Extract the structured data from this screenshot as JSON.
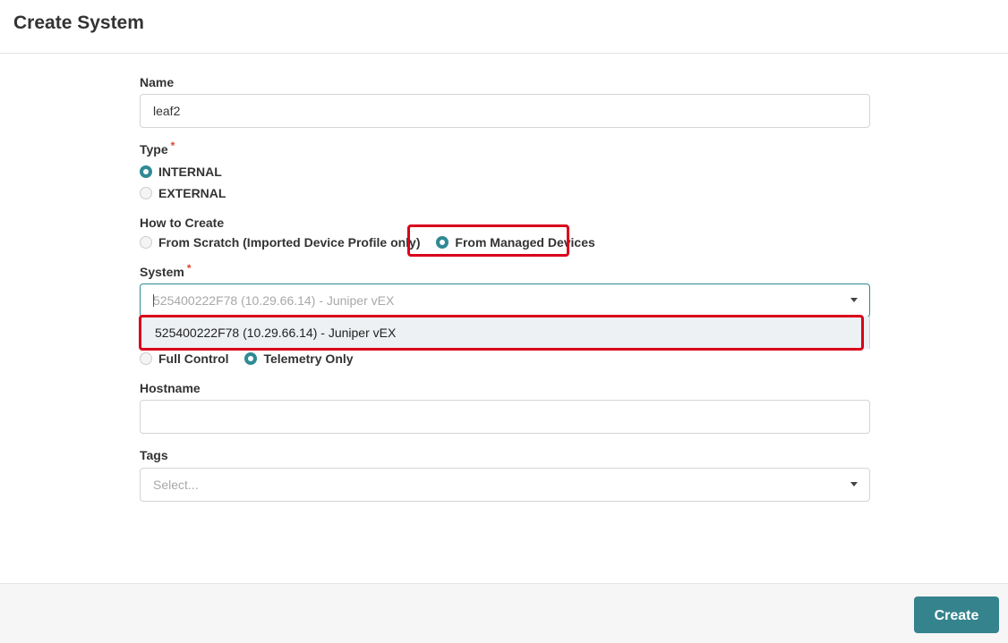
{
  "header": {
    "title": "Create System"
  },
  "form": {
    "name": {
      "label": "Name",
      "value": "leaf2"
    },
    "type": {
      "label": "Type",
      "required_mark": "*",
      "options": [
        {
          "label": "INTERNAL",
          "checked": true
        },
        {
          "label": "EXTERNAL",
          "checked": false
        }
      ]
    },
    "how_to_create": {
      "label": "How to Create",
      "options": [
        {
          "label": "From Scratch (Imported Device Profile only)",
          "checked": false
        },
        {
          "label": "From Managed Devices",
          "checked": true
        }
      ]
    },
    "system": {
      "label": "System",
      "required_mark": "*",
      "placeholder": "525400222F78 (10.29.66.14) - Juniper vEX",
      "dropdown_items": [
        "525400222F78 (10.29.66.14) - Juniper vEX"
      ]
    },
    "control": {
      "options": [
        {
          "label": "Full Control",
          "checked": false
        },
        {
          "label": "Telemetry Only",
          "checked": true
        }
      ]
    },
    "hostname": {
      "label": "Hostname",
      "value": ""
    },
    "tags": {
      "label": "Tags",
      "placeholder": "Select..."
    }
  },
  "footer": {
    "create_label": "Create"
  },
  "colors": {
    "accent": "#35838d",
    "highlight": "#d9001b",
    "required": "#e0412f"
  }
}
